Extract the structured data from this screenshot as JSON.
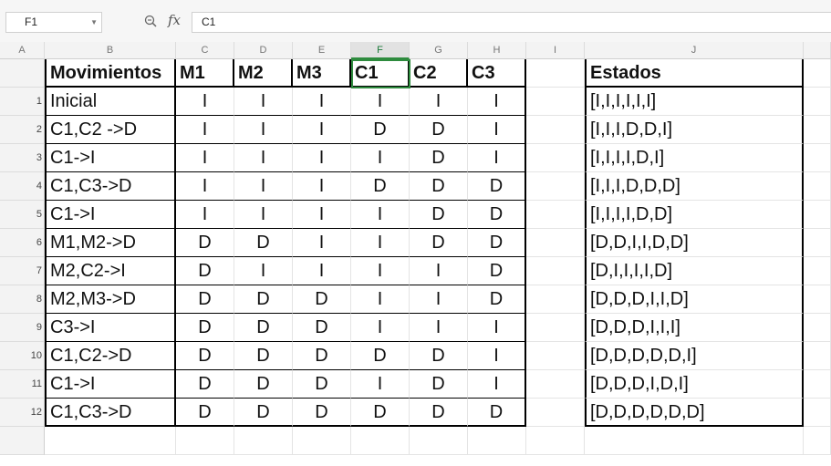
{
  "formula_bar": {
    "name_box": "F1",
    "formula": "C1"
  },
  "icons": {
    "zoom": "zoom-icon",
    "fx": "fx-icon",
    "dropdown": "chevron-down-icon"
  },
  "fx_label": "fx",
  "columns": [
    "A",
    "B",
    "C",
    "D",
    "E",
    "F",
    "G",
    "H",
    "I",
    "J"
  ],
  "selected_column": "F",
  "table_headers": [
    "Movimientos",
    "M1",
    "M2",
    "M3",
    "C1",
    "C2",
    "C3"
  ],
  "estados_header": "Estados",
  "rows": [
    {
      "num": "1",
      "mov": "Inicial",
      "vals": [
        "I",
        "I",
        "I",
        "I",
        "I",
        "I"
      ],
      "estado": "[I,I,I,I,I,I]"
    },
    {
      "num": "2",
      "mov": "C1,C2 ->D",
      "vals": [
        "I",
        "I",
        "I",
        "D",
        "D",
        "I"
      ],
      "estado": "[I,I,I,D,D,I]"
    },
    {
      "num": "3",
      "mov": "C1->I",
      "vals": [
        "I",
        "I",
        "I",
        "I",
        "D",
        "I"
      ],
      "estado": "[I,I,I,I,D,I]"
    },
    {
      "num": "4",
      "mov": "C1,C3->D",
      "vals": [
        "I",
        "I",
        "I",
        "D",
        "D",
        "D"
      ],
      "estado": "[I,I,I,D,D,D]"
    },
    {
      "num": "5",
      "mov": "C1->I",
      "vals": [
        "I",
        "I",
        "I",
        "I",
        "D",
        "D"
      ],
      "estado": "[I,I,I,I,D,D]"
    },
    {
      "num": "6",
      "mov": "M1,M2->D",
      "vals": [
        "D",
        "D",
        "I",
        "I",
        "D",
        "D"
      ],
      "estado": "[D,D,I,I,D,D]"
    },
    {
      "num": "7",
      "mov": "M2,C2->I",
      "vals": [
        "D",
        "I",
        "I",
        "I",
        "I",
        "D"
      ],
      "estado": "[D,I,I,I,I,D]"
    },
    {
      "num": "8",
      "mov": "M2,M3->D",
      "vals": [
        "D",
        "D",
        "D",
        "I",
        "I",
        "D"
      ],
      "estado": "[D,D,D,I,I,D]"
    },
    {
      "num": "9",
      "mov": "C3->I",
      "vals": [
        "D",
        "D",
        "D",
        "I",
        "I",
        "I"
      ],
      "estado": "[D,D,D,I,I,I]"
    },
    {
      "num": "10",
      "mov": "C1,C2->D",
      "vals": [
        "D",
        "D",
        "D",
        "D",
        "D",
        "I"
      ],
      "estado": "[D,D,D,D,D,I]"
    },
    {
      "num": "11",
      "mov": "C1->I",
      "vals": [
        "D",
        "D",
        "D",
        "I",
        "D",
        "I"
      ],
      "estado": "[D,D,D,I,D,I]"
    },
    {
      "num": "12",
      "mov": "C1,C3->D",
      "vals": [
        "D",
        "D",
        "D",
        "D",
        "D",
        "D"
      ],
      "estado": "[D,D,D,D,D,D]"
    }
  ]
}
